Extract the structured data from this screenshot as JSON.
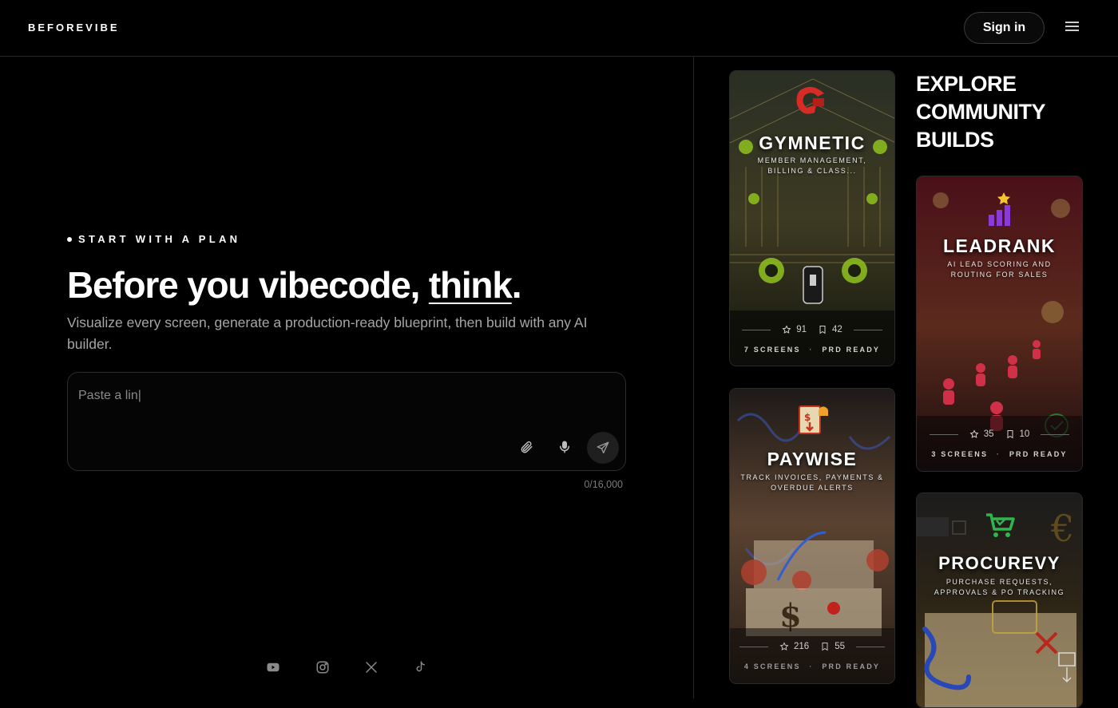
{
  "header": {
    "logo": "BEFOREVIBE",
    "sign_in": "Sign in"
  },
  "hero": {
    "eyebrow": "START WITH A PLAN",
    "headline_pre": "Before you vibecode, ",
    "headline_em": "think",
    "headline_post": ".",
    "subtext": "Visualize every screen, generate a production-ready blueprint, then build with any AI builder."
  },
  "prompt": {
    "value": "Paste a lin|",
    "placeholder": "",
    "counter": "0/16,000"
  },
  "social": [
    "youtube-icon",
    "instagram-icon",
    "x-icon",
    "tiktok-icon"
  ],
  "community": {
    "heading": "EXPLORE COMMUNITY BUILDS",
    "cards": [
      {
        "name": "GYMNETIC",
        "desc": "MEMBER MANAGEMENT, BILLING & CLASS...",
        "stars": "91",
        "saves": "42",
        "screens": "7 SCREENS",
        "status": "PRD READY",
        "accent": "#9bd12a"
      },
      {
        "name": "LEADRANK",
        "desc": "AI LEAD SCORING AND ROUTING FOR SALES",
        "stars": "35",
        "saves": "10",
        "screens": "3 SCREENS",
        "status": "PRD READY",
        "accent": "#e23a52"
      },
      {
        "name": "PAYWISE",
        "desc": "TRACK INVOICES, PAYMENTS & OVERDUE ALERTS",
        "stars": "216",
        "saves": "55",
        "screens": "4 SCREENS",
        "status": "PRD READY",
        "accent": "#d9822b"
      },
      {
        "name": "PROCUREVY",
        "desc": "PURCHASE REQUESTS, APPROVALS & PO TRACKING",
        "accent": "#2fb54a"
      }
    ]
  }
}
